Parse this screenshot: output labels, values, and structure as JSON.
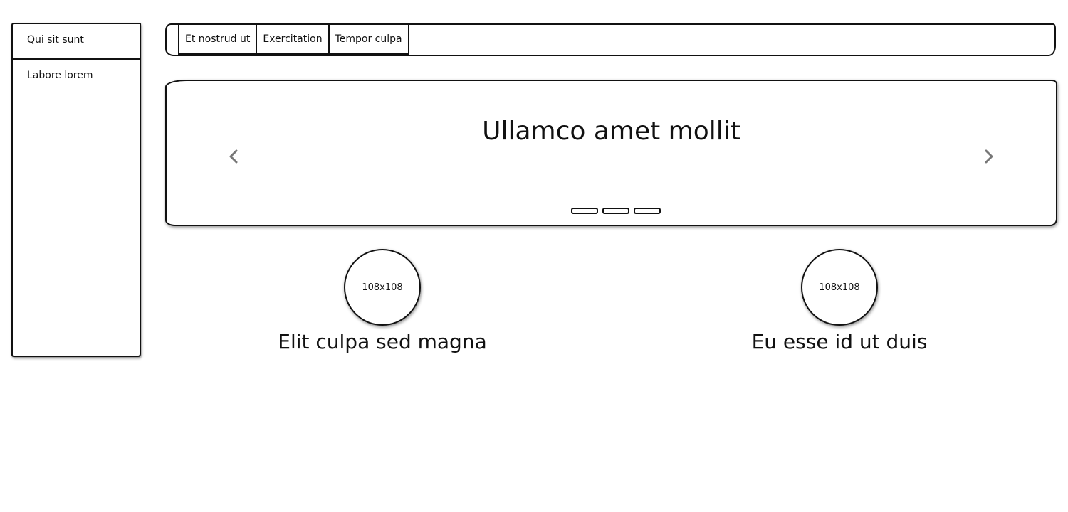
{
  "sidebar": {
    "items": [
      {
        "label": "Qui sit sunt"
      },
      {
        "label": "Labore lorem"
      }
    ]
  },
  "tabs": [
    {
      "label": "Et nostrud ut"
    },
    {
      "label": "Exercitation"
    },
    {
      "label": "Tempor culpa"
    }
  ],
  "carousel": {
    "title": "Ullamco amet mollit",
    "prev_icon": "chevron-left-icon",
    "next_icon": "chevron-right-icon",
    "slide_count": 3
  },
  "features": [
    {
      "image_placeholder": "108x108",
      "title": "Elit culpa sed magna"
    },
    {
      "image_placeholder": "108x108",
      "title": "Eu esse id ut duis"
    }
  ]
}
